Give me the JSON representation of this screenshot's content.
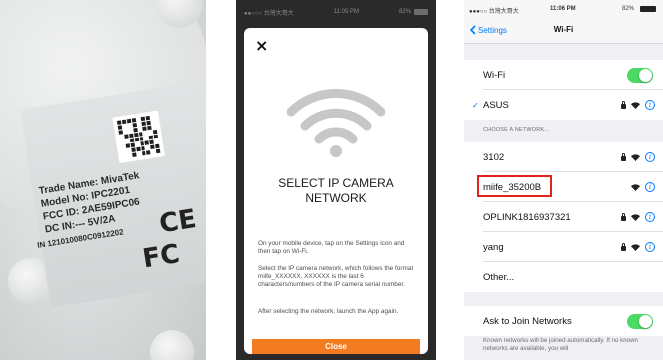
{
  "photo": {
    "label_lines": [
      "Trade Name: MivaTek",
      "Model No: IPC2201",
      "FCC ID: 2AE59IPC06",
      "DC IN:--- 5V/2A",
      "IN 121010080C0912202"
    ],
    "ce_mark": "CE",
    "fc_mark": "FC"
  },
  "app": {
    "status": {
      "carrier": "●●○○○ 台灣大哥大",
      "time": "11:05 PM",
      "battery": "82%"
    },
    "close_icon": "×",
    "title": "SELECT IP CAMERA\nNETWORK",
    "paragraphs": [
      "On your mobile device, tap on the Settings icon and then tap on Wi-Fi.",
      "Select the IP camera network, which follows the format miife_XXXXXX. XXXXXX is the last 6 characters/numbers of the IP camera serial number.",
      "After selecting the network, launch the App again."
    ],
    "close_button": "Close",
    "colors": {
      "accent": "#f47b20"
    }
  },
  "ios": {
    "status": {
      "carrier": "●●●○○ 台灣大哥大",
      "time": "11:06 PM",
      "battery": "82%"
    },
    "back_label": "Settings",
    "nav_title": "Wi-Fi",
    "wifi_row_label": "Wi-Fi",
    "connected_network": "ASUS",
    "section_header": "CHOOSE A NETWORK...",
    "networks": [
      {
        "name": "3102",
        "locked": true
      },
      {
        "name": "miife_35200B",
        "locked": false
      },
      {
        "name": "OPLINK1816937321",
        "locked": true
      },
      {
        "name": "yang",
        "locked": true
      }
    ],
    "other_label": "Other...",
    "ask_label": "Ask to Join Networks",
    "footer": "Known networks will be joined automatically. If no known networks are available, you will",
    "colors": {
      "toggle": "#4cd964",
      "link": "#007aff",
      "highlight": "#e2231a"
    }
  }
}
